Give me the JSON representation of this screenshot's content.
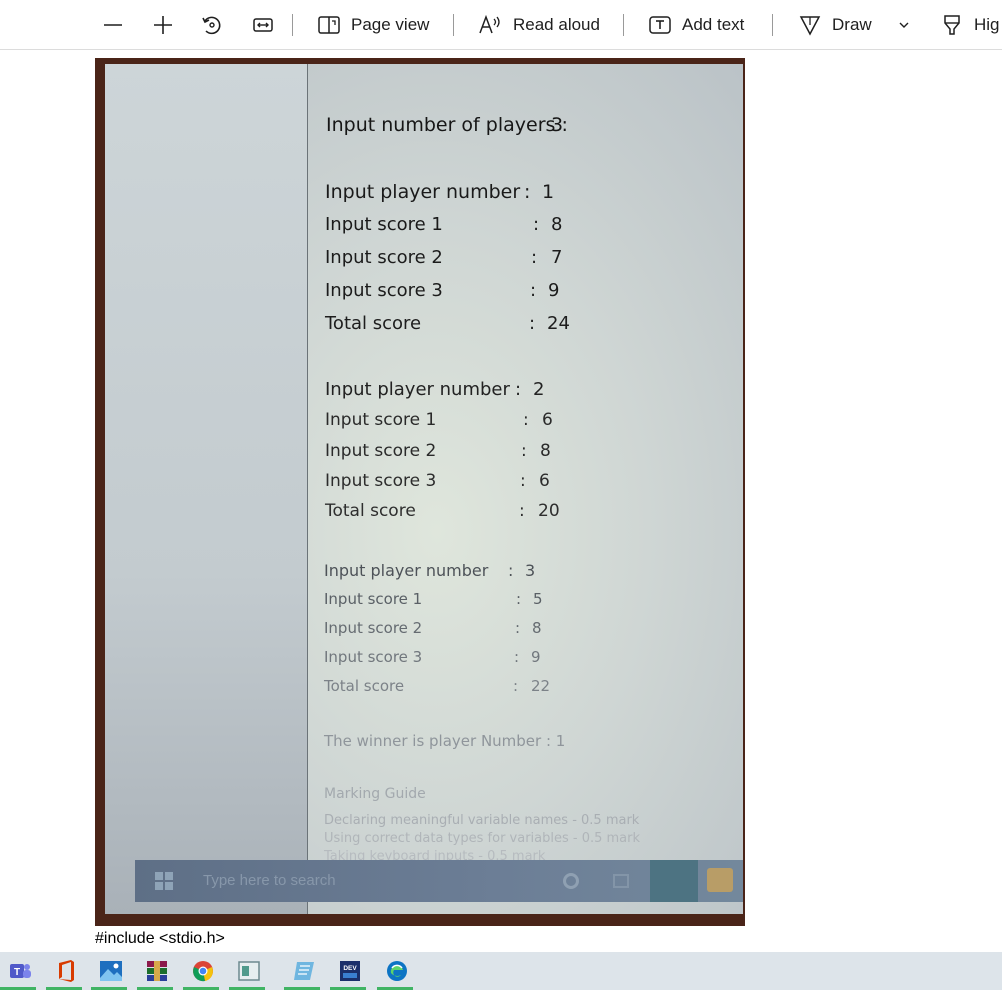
{
  "toolbar": {
    "zoom_out": "zoom-out",
    "zoom_in": "zoom-in",
    "rotate": "rotate",
    "fit": "fit-to-width",
    "page_view": "Page view",
    "read_aloud": "Read aloud",
    "add_text": "Add text",
    "draw": "Draw",
    "highlight": "Hig"
  },
  "photo": {
    "lines": [
      {
        "text": "Input number of players :",
        "value": "3"
      },
      {
        "text": "Input player number",
        "sep": ":",
        "value": "1"
      },
      {
        "text": "Input score 1",
        "sep": ":",
        "value": "8"
      },
      {
        "text": "Input score 2",
        "sep": ":",
        "value": "7"
      },
      {
        "text": "Input score 3",
        "sep": ":",
        "value": "9"
      },
      {
        "text": "Total score",
        "sep": ":",
        "value": "24"
      },
      {
        "text": "Input player number",
        "sep": ":",
        "value": "2"
      },
      {
        "text": "Input score 1",
        "sep": ":",
        "value": "6"
      },
      {
        "text": "Input score 2",
        "sep": ":",
        "value": "8"
      },
      {
        "text": "Input score 3",
        "sep": ":",
        "value": "6"
      },
      {
        "text": "Total score",
        "sep": ":",
        "value": "20"
      },
      {
        "text": "Input player number",
        "sep": ":",
        "value": "3"
      },
      {
        "text": "Input score 1",
        "sep": ":",
        "value": "5"
      },
      {
        "text": "Input score 2",
        "sep": ":",
        "value": "8"
      },
      {
        "text": "Input score 3",
        "sep": ":",
        "value": "9"
      },
      {
        "text": "Total score",
        "sep": ":",
        "value": "22"
      }
    ],
    "winner": "The winner is player Number : 1",
    "marking_title": "Marking Guide",
    "marking_lines": [
      "Declaring meaningful variable names - 0.5 mark",
      "Using correct data types for variables - 0.5 mark",
      "Taking keyboard inputs - 0.5 mark"
    ],
    "taskbar_search": "Type here to search"
  },
  "document": {
    "code_line": "#include <stdio.h>"
  },
  "taskbar": {
    "apps": [
      "teams-icon",
      "office-icon",
      "photos-icon",
      "winrar-icon",
      "chrome-icon",
      "app-window-icon",
      "notepad-icon",
      "dev-cpp-icon",
      "edge-icon"
    ],
    "accent_color": "#40b464"
  }
}
